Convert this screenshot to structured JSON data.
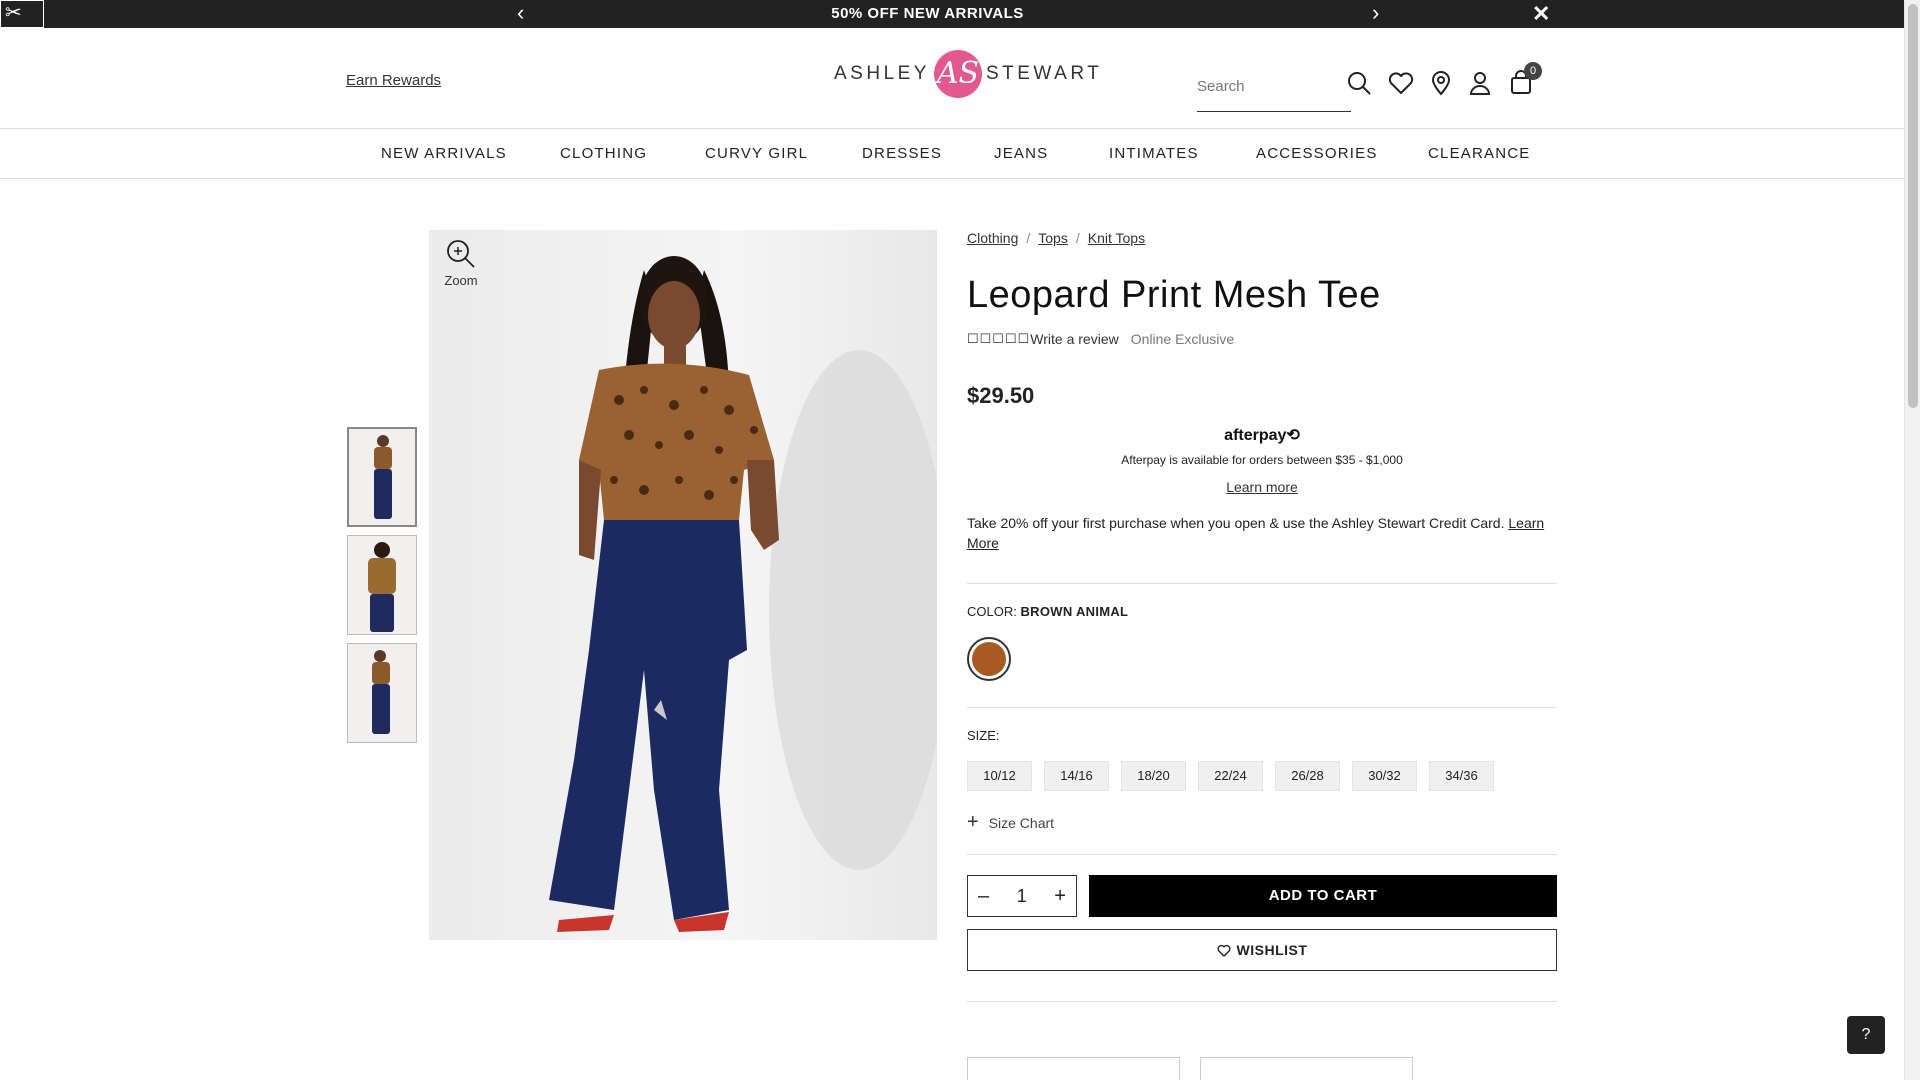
{
  "promo": {
    "message": "50% OFF NEW ARRIVALS",
    "prev": "‹",
    "next": "›",
    "close": "✕"
  },
  "header": {
    "earn_rewards": "Earn Rewards",
    "logo_left": "ASHLEY",
    "logo_mono": "AS",
    "logo_right": "STEWART",
    "search_placeholder": "Search",
    "cart_count": "0"
  },
  "nav": [
    "NEW ARRIVALS",
    "CLOTHING",
    "CURVY GIRL",
    "DRESSES",
    "JEANS",
    "INTIMATES",
    "ACCESSORIES",
    "CLEARANCE"
  ],
  "gallery": {
    "zoom_label": "Zoom"
  },
  "product": {
    "breadcrumbs": [
      "Clothing",
      "Tops",
      "Knit Tops"
    ],
    "title": "Leopard Print Mesh Tee",
    "stars": "☐☐☐☐☐",
    "write_review": "Write a review",
    "online_exclusive": "Online Exclusive",
    "price": "$29.50",
    "afterpay_logo": "afterpay⟲",
    "afterpay_text": "Afterpay is available for orders between $35 - $1,000",
    "afterpay_learn": "Learn more",
    "credit_text": "Take 20% off your first purchase when you open & use the Ashley Stewart Credit Card.",
    "credit_link": "Learn More",
    "color_label": "COLOR:",
    "color_value": "BROWN ANIMAL",
    "swatch_color": "#a85a22",
    "size_label": "SIZE:",
    "sizes": [
      "10/12",
      "14/16",
      "18/20",
      "22/24",
      "26/28",
      "30/32",
      "34/36"
    ],
    "size_chart": "Size Chart",
    "qty_minus": "–",
    "qty": "1",
    "qty_plus": "+",
    "add_to_cart": "ADD TO CART",
    "wishlist": "WISHLIST"
  },
  "help_icon": "?"
}
